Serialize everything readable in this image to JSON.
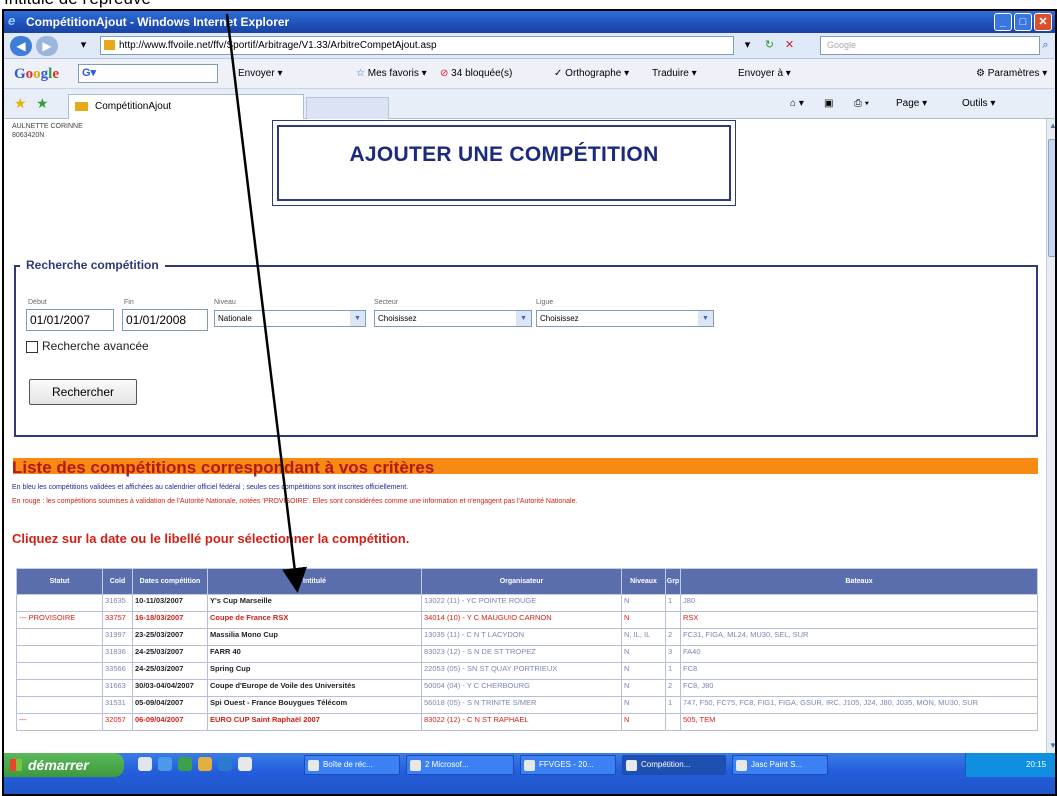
{
  "caption": "Intitulé  de l'épreuve",
  "window": {
    "title": "CompétitionAjout - Windows Internet Explorer",
    "minimize": "_",
    "maximize": "□",
    "close": "✕"
  },
  "address": {
    "url": "http://www.ffvoile.net/ffv/Sportif/Arbitrage/V1.33/ArbitreCompetAjout.asp",
    "search_placeholder": "Google",
    "back": "◀",
    "forward": "▶"
  },
  "google_toolbar": {
    "logo_letters": [
      "G",
      "o",
      "o",
      "g",
      "l",
      "e"
    ],
    "input_value": "G▾",
    "items": [
      "Envoyer ▾",
      "Mes favoris ▾",
      "34 bloquée(s)",
      "Orthographe ▾",
      "Traduire ▾",
      "Envoyer à ▾",
      "Paramètres ▾"
    ]
  },
  "tabs": {
    "current": "CompétitionAjout",
    "page_menu": "Page ▾",
    "tools_menu": "Outils ▾"
  },
  "user": {
    "name": "AULNETTE CORINNE",
    "id": "8063420N"
  },
  "page_title": "AJOUTER UNE COMPÉTITION",
  "search": {
    "legend": "Recherche compétition",
    "labels": {
      "debut": "Début",
      "fin": "Fin",
      "niveau": "Niveau",
      "secteur": "Secteur",
      "ligue": "Ligue"
    },
    "debut": "01/01/2007",
    "fin": "01/01/2008",
    "niveau": "Nationale",
    "secteur": "Choisissez",
    "ligue": "Choisissez",
    "advanced": "Recherche avancée",
    "button": "Rechercher"
  },
  "list": {
    "title": "Liste des compétitions correspondant à vos critères",
    "info_blue": "En bleu les compétitions validées et affichées au calendrier officiel fédéral ; seules ces compétitions sont inscrites officiellement.",
    "info_red": "En rouge : les compétitions soumises à validation de l'Autorité Nationale, notées 'PROVISOIRE'. Elles sont considérées comme une information et n'engagent pas l'Autorité Nationale.",
    "instruction": "Cliquez sur la date ou le libellé pour sélectionner la compétition."
  },
  "table": {
    "headers": [
      "Statut",
      "Cold",
      "Dates compétition",
      "Intitulé",
      "Organisateur",
      "Niveaux",
      "Grp",
      "Bateaux"
    ],
    "rows": [
      {
        "statut": "",
        "cold": "31635",
        "dates": "10-11/03/2007",
        "intitule": "Y's Cup Marseille",
        "org": "13022 (11) - YC POINTE ROUGE",
        "niveau": "N",
        "grp": "1",
        "bateaux": "J80",
        "prov": false
      },
      {
        "statut": "--- PROVISOIRE",
        "cold": "33757",
        "dates": "16-18/03/2007",
        "intitule": "Coupe de France RSX",
        "org": "34014 (10) - Y C MAUGUIO CARNON",
        "niveau": "N",
        "grp": "",
        "bateaux": "RSX",
        "prov": true
      },
      {
        "statut": "",
        "cold": "31997",
        "dates": "23-25/03/2007",
        "intitule": "Massilia Mono Cup",
        "org": "13035 (11) - C N T LACYDON",
        "niveau": "N, IL, IL",
        "grp": "2",
        "bateaux": "FC31, FIGA, ML24, MU30, SEL, SUR",
        "prov": false
      },
      {
        "statut": "",
        "cold": "31836",
        "dates": "24-25/03/2007",
        "intitule": "FARR 40",
        "org": "83023 (12) - S N DE ST TROPEZ",
        "niveau": "N",
        "grp": "3",
        "bateaux": "FA40",
        "prov": false
      },
      {
        "statut": "",
        "cold": "33566",
        "dates": "24-25/03/2007",
        "intitule": "Spring Cup",
        "org": "22053 (05) - SN ST QUAY PORTRIEUX",
        "niveau": "N",
        "grp": "1",
        "bateaux": "FC8",
        "prov": false
      },
      {
        "statut": "",
        "cold": "31663",
        "dates": "30/03-04/04/2007",
        "intitule": "Coupe d'Europe de Voile des Universités",
        "org": "50004 (04) - Y C CHERBOURG",
        "niveau": "N",
        "grp": "2",
        "bateaux": "FC8, J80",
        "prov": false
      },
      {
        "statut": "",
        "cold": "31531",
        "dates": "05-09/04/2007",
        "intitule": "Spi Ouest - France Bouygues Télécom",
        "org": "56018 (05) - S N TRINITE S/MER",
        "niveau": "N",
        "grp": "1",
        "bateaux": "747, F50, FC75, FC8, FIG1, FIGA, GSUR, IRC, J105, J24, J80, J035, MON, MU30, SUR",
        "prov": false
      },
      {
        "statut": "---",
        "cold": "32057",
        "dates": "06-09/04/2007",
        "intitule": "EURO CUP Saint Raphaël 2007",
        "org": "83022 (12) - C N ST RAPHAEL",
        "niveau": "N",
        "grp": "",
        "bateaux": "505, TEM",
        "prov": true
      }
    ]
  },
  "taskbar": {
    "start": "démarrer",
    "tasks": [
      "Boîte de réc...",
      "2 Microsof...",
      "FFVGES - 20...",
      "Compétition...",
      "Jasc Paint S..."
    ],
    "clock": "20:15"
  }
}
